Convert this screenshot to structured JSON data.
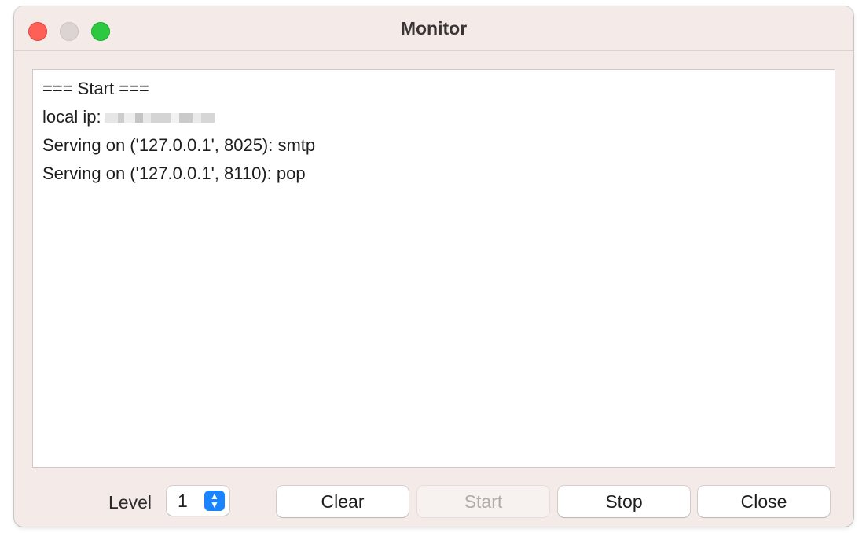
{
  "window": {
    "title": "Monitor"
  },
  "log": {
    "lines": [
      "=== Start ===",
      "local ip:",
      "Serving on ('127.0.0.1', 8025): smtp",
      "Serving on ('127.0.0.1', 8110): pop"
    ]
  },
  "controls": {
    "level_label": "Level",
    "level_value": "1",
    "buttons": {
      "clear": "Clear",
      "start": "Start",
      "stop": "Stop",
      "close": "Close"
    }
  },
  "colors": {
    "window_bg": "#f4ebe9",
    "close_light": "#fe5f57",
    "minimize_light": "#dcd4d2",
    "zoom_light": "#2bc840",
    "accent": "#1a84ff"
  },
  "icons": {
    "stepper": "chevron-up-down-icon"
  }
}
